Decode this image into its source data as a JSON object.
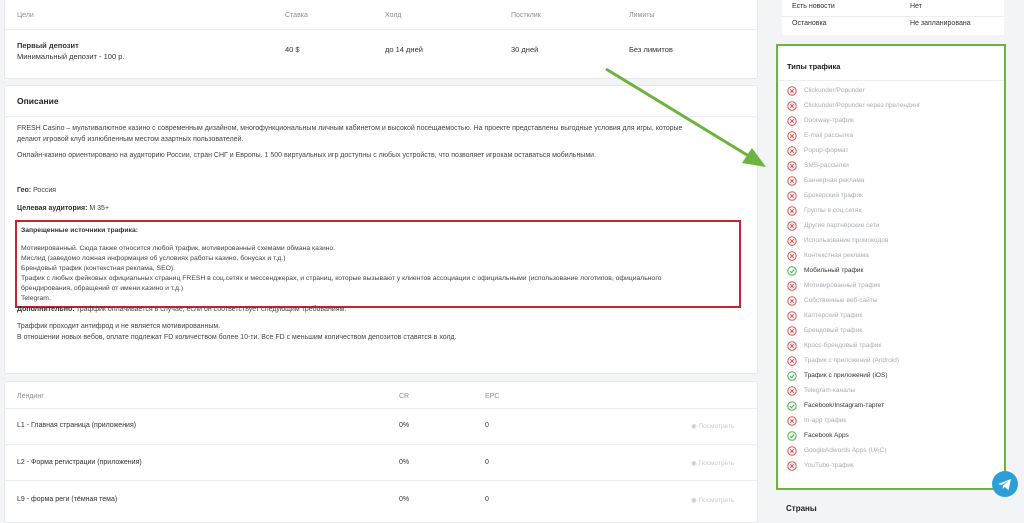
{
  "goals": {
    "headers": [
      "Цели",
      "Ставка",
      "Холд",
      "Постклик",
      "Лимиты"
    ],
    "row": {
      "title": "Первый депозит",
      "subtitle": "Минимальный депозит - 100 р.",
      "rate": "40 $",
      "hold": "до 14 дней",
      "postclick": "30 дней",
      "limits": "Без лимитов"
    }
  },
  "description": {
    "title": "Описание",
    "p1": "FRESH Casino – мультивалютное казино с современным дизайном, многофункциональным личным кабинетом и высокой посещаемостью. На проекте представлены выгодные условия для игры, которые",
    "p1b": "делают игровой клуб излюбленным местом азартных пользователей.",
    "p2": "Онлайн-казино ориентировано на аудиторию России, стран СНГ и Европы. 1 500 виртуальных игр доступны с любых устройств, что позволяет игрокам оставаться мобильными.",
    "geo_label": "Гео:",
    "geo_value": " Россия",
    "audience_label": "Целевая аудитория:",
    "audience_value": " М 35+",
    "forbidden_title": "Запрещенные источники трафика:",
    "forbidden_lines": [
      "Мотивированный. Сюда также относится любой трафик, мотивированный схемами обмана казино.",
      "Мислид (заведомо ложная информация об условиях работы казино, бонусах и т.д.)",
      "Брендовый трафик (контекстная реклама, SEO).",
      "Трафик с любых фейковых официальных страниц FRESH в соц.сетях и мессенджерах, и страниц, которые вызывают у клиентов ассоциации с официальными (использование логотипов, официального",
      "брендирования, обращений от имени казино и т.д.)",
      "Telegram."
    ],
    "extra_label": "Дополнительно:",
    "extra_value": " траффик оплачивается в случае, если он соответствует следующим требованиям:",
    "req1": "Траффик проходит антифрод и не является мотивированным.",
    "req2": "В отношении новых вебов, оплате подлежат FD количеством более 10-ти. Все FD с меньшим количеством депозитов ставятся в холд."
  },
  "landings": {
    "headers": [
      "Лендинг",
      "CR",
      "EPC"
    ],
    "view_label": "Посмотреть",
    "rows": [
      {
        "name": "L1 - Главная страница (приложения)",
        "cr": "0%",
        "epc": "0"
      },
      {
        "name": "L2 - Форма регистрации (приложения)",
        "cr": "0%",
        "epc": "0"
      },
      {
        "name": "L9 - форма реги (тёмная тема)",
        "cr": "0%",
        "epc": "0"
      }
    ]
  },
  "info": {
    "news_label": "Есть новости",
    "news_value": "Нет",
    "stop_label": "Остановка",
    "stop_value": "Не запланирована"
  },
  "traffic": {
    "title": "Типы трафика",
    "items": [
      {
        "label": "Clickunder/Popunder",
        "allowed": false
      },
      {
        "label": "Clickunder/Popunder через прелендинг",
        "allowed": false
      },
      {
        "label": "Doorway-трафик",
        "allowed": false
      },
      {
        "label": "E-mail рассылка",
        "allowed": false
      },
      {
        "label": "Popup-формат",
        "allowed": false
      },
      {
        "label": "SMS-рассылки",
        "allowed": false
      },
      {
        "label": "Баннерная реклама",
        "allowed": false
      },
      {
        "label": "Брокерский трафик",
        "allowed": false
      },
      {
        "label": "Группы в соц.сетях",
        "allowed": false
      },
      {
        "label": "Другие партнёрские сети",
        "allowed": false
      },
      {
        "label": "Использование промокодов",
        "allowed": false
      },
      {
        "label": "Контекстная реклама",
        "allowed": false
      },
      {
        "label": "Мобильный трафик",
        "allowed": true
      },
      {
        "label": "Мотивированный трафик",
        "allowed": false
      },
      {
        "label": "Собственные веб-сайты",
        "allowed": false
      },
      {
        "label": "Каптерский трафик",
        "allowed": false
      },
      {
        "label": "Брендовый трафик",
        "allowed": false
      },
      {
        "label": "Кросс-брендовый трафик",
        "allowed": false
      },
      {
        "label": "Трафик с приложений (Android)",
        "allowed": false
      },
      {
        "label": "Трафик с приложений (iOS)",
        "allowed": true
      },
      {
        "label": "Telegram-каналы",
        "allowed": false
      },
      {
        "label": "Facebook/Instagram-таргет",
        "allowed": true
      },
      {
        "label": "In-app трафик",
        "allowed": false
      },
      {
        "label": "Facebook Apps",
        "allowed": true
      },
      {
        "label": "GoogleAdwords Apps (UAC)",
        "allowed": false
      },
      {
        "label": "YouTube-трафик",
        "allowed": false
      }
    ]
  },
  "countries": {
    "title": "Страны"
  },
  "colors": {
    "forbidden": "#d9534f",
    "allowed": "#4caf50",
    "highlight_red": "#c0262f",
    "highlight_green": "#6db33f"
  }
}
